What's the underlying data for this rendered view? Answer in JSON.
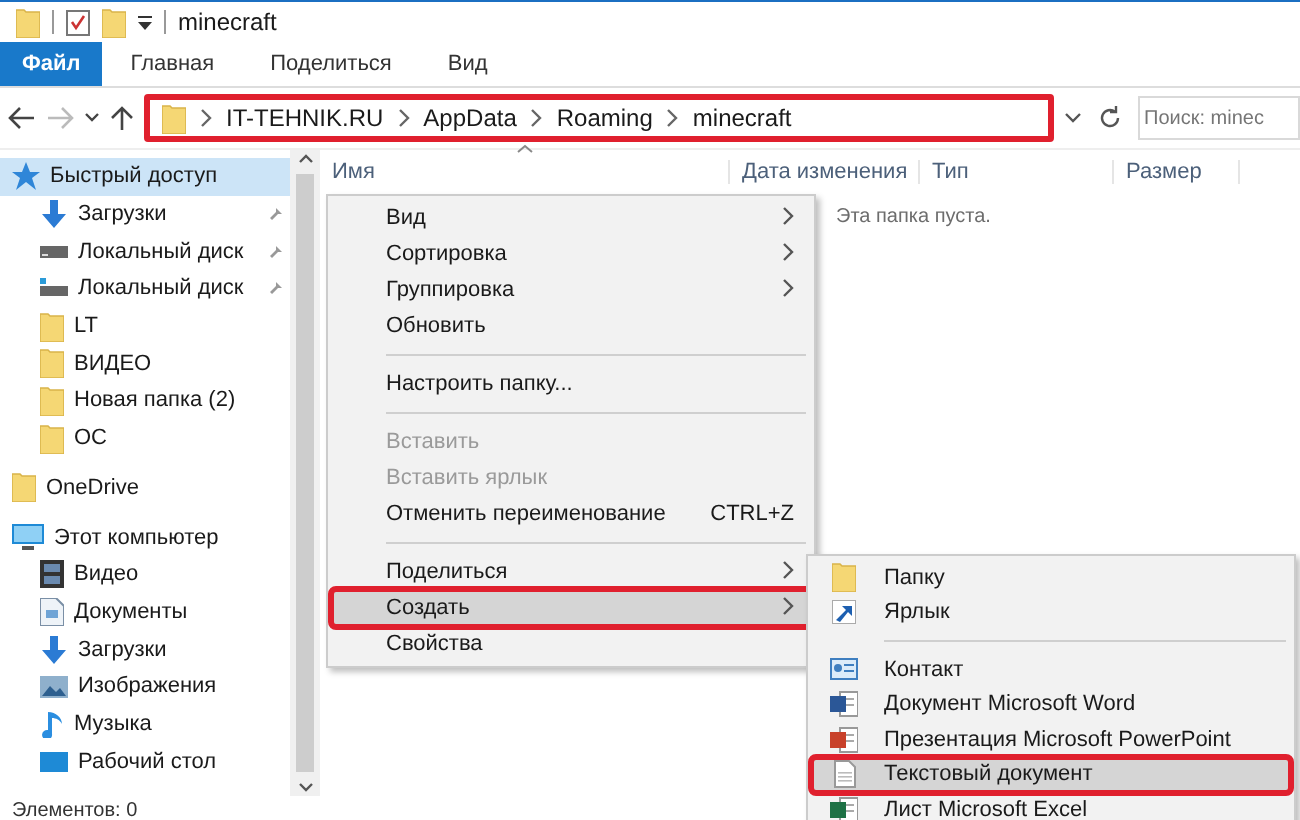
{
  "window": {
    "title": "minecraft"
  },
  "ribbon_tabs": [
    {
      "label": "Файл",
      "kind": "file",
      "selected": false
    },
    {
      "label": "Главная",
      "kind": "tab",
      "selected": false
    },
    {
      "label": "Поделиться",
      "kind": "tab",
      "selected": false
    },
    {
      "label": "Вид",
      "kind": "tab",
      "selected": false
    }
  ],
  "address_bar": {
    "highlighted": true,
    "path": [
      "IT-TEHNIK.RU",
      "AppData",
      "Roaming",
      "minecraft"
    ]
  },
  "search": {
    "placeholder": "Поиск: minec"
  },
  "sidebar": {
    "items": [
      {
        "label": "Быстрый доступ",
        "kind": "star",
        "selected": true,
        "children": [
          {
            "label": "Загрузки",
            "kind": "download",
            "pinned": true
          },
          {
            "label": "Локальный диск",
            "kind": "drive",
            "pinned": true
          },
          {
            "label": "Локальный диск",
            "kind": "netdrive",
            "pinned": true
          },
          {
            "label": "LT",
            "kind": "folder",
            "pinned": false
          },
          {
            "label": "ВИДЕО",
            "kind": "folder",
            "pinned": false
          },
          {
            "label": "Новая папка (2)",
            "kind": "folder",
            "pinned": false
          },
          {
            "label": "OC",
            "kind": "folder",
            "pinned": false
          }
        ]
      },
      {
        "label": "OneDrive",
        "kind": "folder",
        "selected": false
      },
      {
        "label": "Этот компьютер",
        "kind": "computer",
        "selected": false,
        "children": [
          {
            "label": "Видео",
            "kind": "video",
            "pinned": false
          },
          {
            "label": "Документы",
            "kind": "document",
            "pinned": false
          },
          {
            "label": "Загрузки",
            "kind": "download",
            "pinned": false
          },
          {
            "label": "Изображения",
            "kind": "image",
            "pinned": false
          },
          {
            "label": "Музыка",
            "kind": "music",
            "pinned": false
          },
          {
            "label": "Рабочий стол",
            "kind": "desktop",
            "pinned": false
          }
        ]
      }
    ]
  },
  "columns": [
    "Имя",
    "Дата изменения",
    "Тип",
    "Размер"
  ],
  "empty_message": "Эта папка пуста.",
  "context_menu": [
    {
      "kind": "item",
      "label": "Вид",
      "submenu": true,
      "disabled": false,
      "selected": false,
      "highlighted": false
    },
    {
      "kind": "item",
      "label": "Сортировка",
      "submenu": true,
      "disabled": false,
      "selected": false,
      "highlighted": false
    },
    {
      "kind": "item",
      "label": "Группировка",
      "submenu": true,
      "disabled": false,
      "selected": false,
      "highlighted": false
    },
    {
      "kind": "item",
      "label": "Обновить",
      "submenu": false,
      "disabled": false,
      "selected": false,
      "highlighted": false
    },
    {
      "kind": "separator"
    },
    {
      "kind": "item",
      "label": "Настроить папку...",
      "submenu": false,
      "disabled": false,
      "selected": false,
      "highlighted": false
    },
    {
      "kind": "separator"
    },
    {
      "kind": "item",
      "label": "Вставить",
      "submenu": false,
      "disabled": true,
      "selected": false,
      "highlighted": false
    },
    {
      "kind": "item",
      "label": "Вставить ярлык",
      "submenu": false,
      "disabled": true,
      "selected": false,
      "highlighted": false
    },
    {
      "kind": "item",
      "label": "Отменить переименование",
      "shortcut": "CTRL+Z",
      "submenu": false,
      "disabled": false,
      "selected": false,
      "highlighted": false
    },
    {
      "kind": "separator"
    },
    {
      "kind": "item",
      "label": "Поделиться",
      "submenu": true,
      "disabled": false,
      "selected": false,
      "highlighted": false
    },
    {
      "kind": "item",
      "label": "Создать",
      "submenu": true,
      "disabled": false,
      "selected": true,
      "highlighted": true
    },
    {
      "kind": "item",
      "label": "Свойства",
      "submenu": false,
      "disabled": false,
      "selected": false,
      "highlighted": false
    }
  ],
  "create_submenu": [
    {
      "kind": "folder",
      "label": "Папку",
      "selected": false,
      "highlighted": false
    },
    {
      "kind": "shortcut",
      "label": "Ярлык",
      "selected": false,
      "highlighted": false
    },
    {
      "kind": "separator"
    },
    {
      "kind": "contact",
      "label": "Контакт",
      "selected": false,
      "highlighted": false
    },
    {
      "kind": "word",
      "label": "Документ Microsoft Word",
      "selected": false,
      "highlighted": false
    },
    {
      "kind": "powerpoint",
      "label": "Презентация Microsoft PowerPoint",
      "selected": false,
      "highlighted": false
    },
    {
      "kind": "text",
      "label": "Текстовый документ",
      "selected": true,
      "highlighted": true
    },
    {
      "kind": "excel",
      "label": "Лист Microsoft Excel",
      "selected": false,
      "highlighted": false
    }
  ],
  "status_bar": "Элементов: 0"
}
